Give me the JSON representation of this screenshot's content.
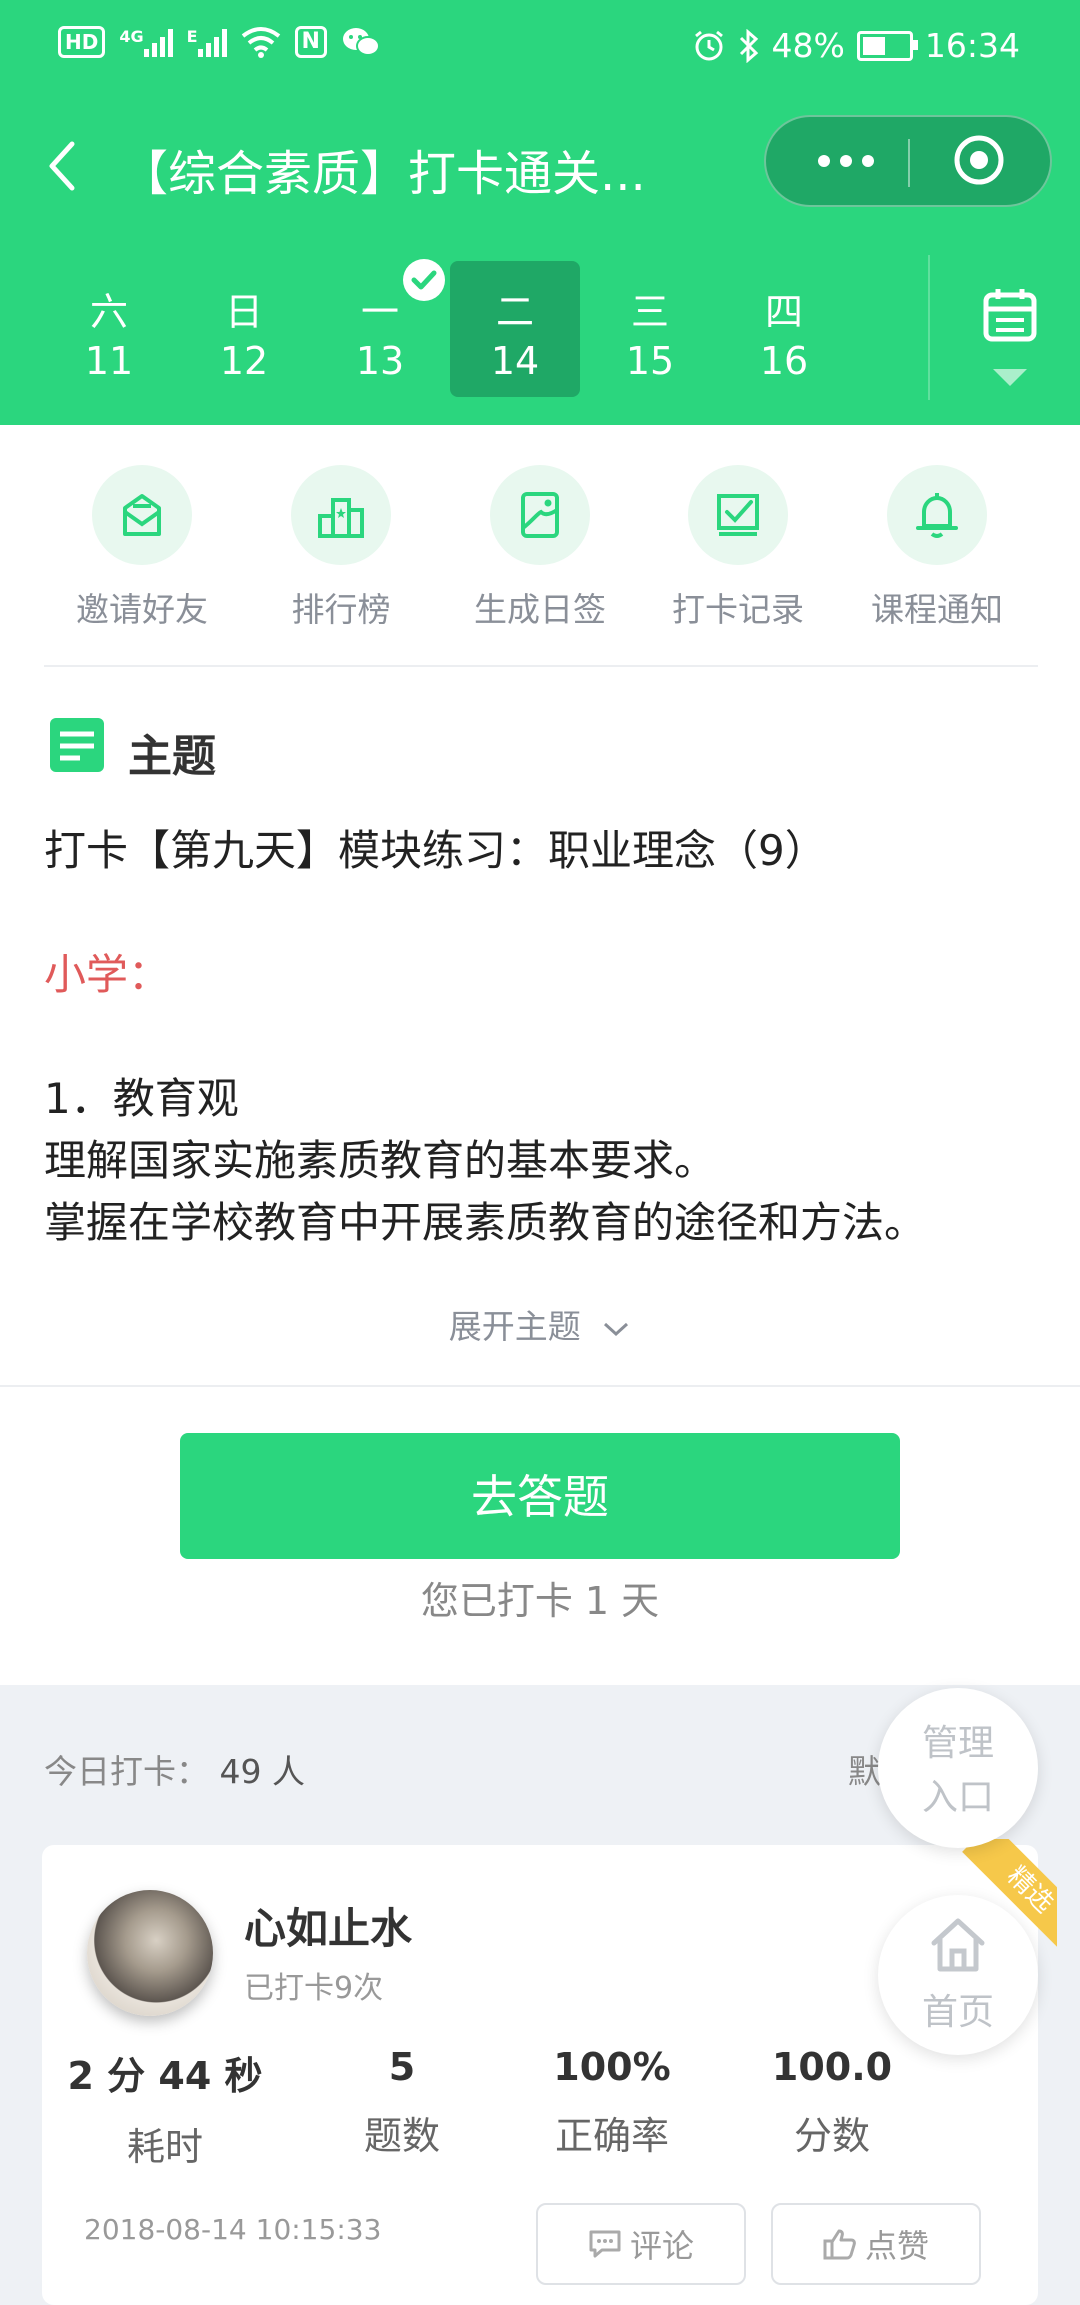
{
  "status_bar": {
    "left_icons": [
      "hd-icon",
      "signal-4g-icon",
      "signal-e-icon",
      "wifi-icon",
      "nfc-icon",
      "wechat-icon"
    ],
    "hd_label": "HD",
    "network_4g": "4G",
    "network_e": "E",
    "nfc_label": "N",
    "battery": "48%",
    "time": "16:34"
  },
  "navbar": {
    "title": "【综合素质】打卡通关..."
  },
  "days": [
    {
      "weekday": "六",
      "date": "11",
      "checked": false,
      "active": false
    },
    {
      "weekday": "日",
      "date": "12",
      "checked": false,
      "active": false
    },
    {
      "weekday": "一",
      "date": "13",
      "checked": true,
      "active": false
    },
    {
      "weekday": "二",
      "date": "14",
      "checked": false,
      "active": true
    },
    {
      "weekday": "三",
      "date": "15",
      "checked": false,
      "active": false
    },
    {
      "weekday": "四",
      "date": "16",
      "checked": false,
      "active": false
    }
  ],
  "actions": [
    {
      "label": "邀请好友",
      "icon": "invite-envelope-icon"
    },
    {
      "label": "排行榜",
      "icon": "ranking-podium-icon"
    },
    {
      "label": "生成日签",
      "icon": "daily-card-icon"
    },
    {
      "label": "打卡记录",
      "icon": "checkin-record-icon"
    },
    {
      "label": "课程通知",
      "icon": "bell-icon"
    }
  ],
  "topic": {
    "heading": "主题",
    "line1": "打卡【第九天】模块练习：职业理念（9）",
    "section_label": "小学：",
    "item_title": "1．教育观",
    "item_line1": "理解国家实施素质教育的基本要求。",
    "item_line2": "掌握在学校教育中开展素质教育的途径和方法。",
    "expand_label": "展开主题"
  },
  "cta": {
    "button_label": "去答题",
    "streak_text": "您已打卡 1 天"
  },
  "today": {
    "label": "今日打卡：",
    "count": "49 人",
    "sort_label": "默"
  },
  "float_buttons": {
    "manage_line1": "管理",
    "manage_line2": "入口",
    "home_label": "首页"
  },
  "post": {
    "name": "心如止水",
    "checkin_count": "已打卡9次",
    "ribbon": "精选",
    "stats": [
      {
        "value": "2 分 44 秒",
        "label": "耗时"
      },
      {
        "value": "5",
        "label": "题数"
      },
      {
        "value": "100%",
        "label": "正确率"
      },
      {
        "value": "100.0",
        "label": "分数"
      }
    ],
    "timestamp": "2018-08-14 10:15:33",
    "comment_label": "评论",
    "like_label": "点赞"
  },
  "colors": {
    "brand_green": "#2bd67e",
    "active_green": "#1fa866",
    "highlight_red": "#e05a5a",
    "ribbon_yellow": "#f6c84a"
  }
}
